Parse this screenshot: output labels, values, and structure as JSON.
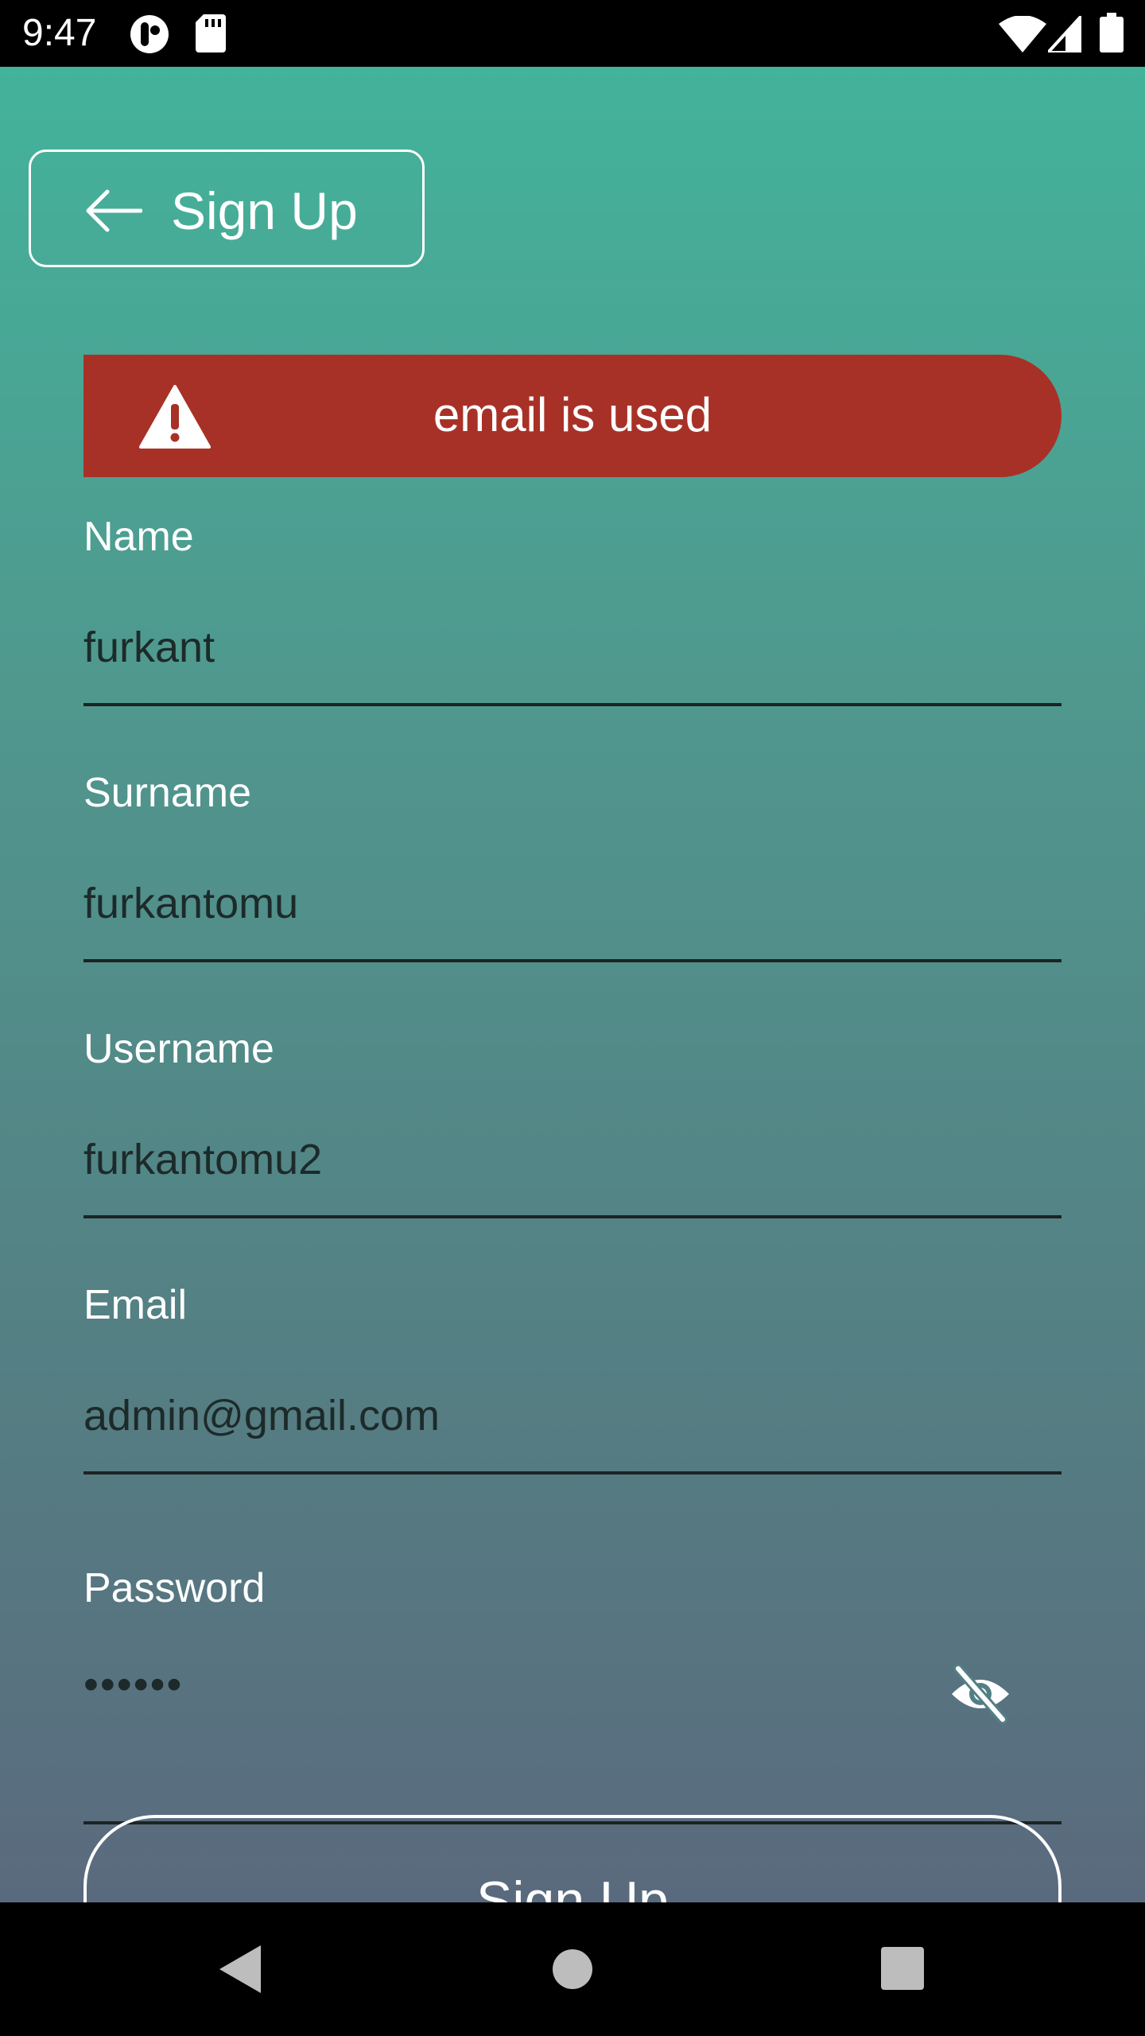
{
  "status_bar": {
    "time": "9:47",
    "icons": [
      "app-notification-icon",
      "sd-card-icon",
      "wifi-icon",
      "signal-icon",
      "battery-icon"
    ]
  },
  "header": {
    "back_icon": "arrow-left-icon",
    "title": "Sign Up"
  },
  "alert": {
    "icon": "warning-triangle-icon",
    "message": "email is used",
    "color": "#a83127"
  },
  "form": {
    "name": {
      "label": "Name",
      "value": "furkant"
    },
    "surname": {
      "label": "Surname",
      "value": "furkantomu"
    },
    "username": {
      "label": "Username",
      "value": "furkantomu2"
    },
    "email": {
      "label": "Email",
      "value": "admin@gmail.com"
    },
    "password": {
      "label": "Password",
      "value": "••••••",
      "toggle_icon": "eye-off-icon"
    }
  },
  "submit": {
    "label": "Sign Up"
  },
  "nav_bar": {
    "back": "nav-back-icon",
    "home": "nav-home-icon",
    "recents": "nav-recents-icon"
  },
  "colors": {
    "gradient_top": "#43b39b",
    "gradient_bottom": "#5a6a7e",
    "alert_red": "#a83127"
  }
}
